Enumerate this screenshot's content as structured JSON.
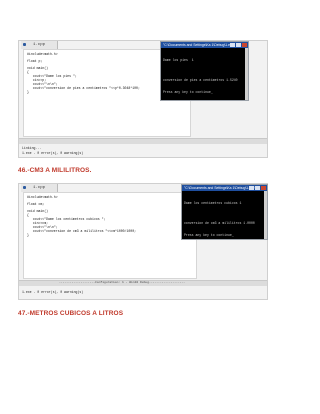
{
  "shot1": {
    "tab": "1.cpp",
    "code": [
      "#include<math.h>",
      "float p;",
      "void main()",
      "{",
      "   cout<<\"Dame los pies \";",
      "   cin>>p;",
      "   cout<<\"\\n\\n\";",
      "   cout<<\"conversion de pies a centimetros \"<<p*0.3048*100;",
      "}"
    ],
    "log": [
      "Linking...",
      "1.exe - 0 error(s), 0 warning(s)"
    ],
    "console": {
      "title": "\"C:\\Documents and Settings\\Ka 1\\Debug\\1.exe\"",
      "lines": [
        "Dame los pies  1",
        "",
        "conversion de pies a centimetros 1.5240",
        "Press any key to continue_"
      ]
    }
  },
  "heading1": "46.-CM3 A MILILITROS.",
  "shot2": {
    "tab": "1.cpp",
    "code": [
      "#include<math.h>",
      "float cm;",
      "void main()",
      "{",
      "   cout<<\"Dame los centimetros cubicos \";",
      "   cin>>cm;",
      "   cout<<\"\\n\\n\";",
      "   cout<<\"conversion de cm3 a mililitros \"<<cm*1000/1000;",
      "}"
    ],
    "status": "--------------------Configuration: 1 - Win32 Debug--------------------",
    "log": [
      "1.exe - 0 error(s), 0 warning(s)"
    ],
    "console": {
      "title": "\"C:\\Documents and Settings\\Ka 1\\Debug\\1.exe\"",
      "lines": [
        "Dame los centimetros cubicos 1",
        "",
        "conversion de cm3 a mililitros 1.0000",
        "Press any key to continue_"
      ]
    }
  },
  "heading2": "47.-METROS CUBICOS A LITROS"
}
